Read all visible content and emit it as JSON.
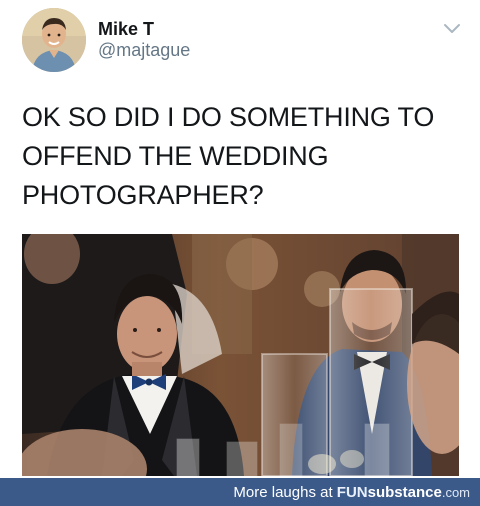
{
  "tweet": {
    "author_name": "Mike T",
    "author_handle": "@majtague",
    "text_lines": [
      "OK SO DID I DO SOMETHING TO",
      "OFFEND THE WEDDING",
      "PHOTOGRAPHER?"
    ]
  },
  "icons": {
    "avatar": "avatar-icon",
    "menu": "chevron-down-icon",
    "photo": "wedding-photo-image"
  },
  "footer": {
    "prefix": "More laughs at ",
    "brand_fun": "FUN",
    "brand_sub": "substance",
    "brand_dom": ".com"
  },
  "colors": {
    "text": "#14171a",
    "handle": "#657786",
    "footer_bg": "#3b5a8a"
  }
}
